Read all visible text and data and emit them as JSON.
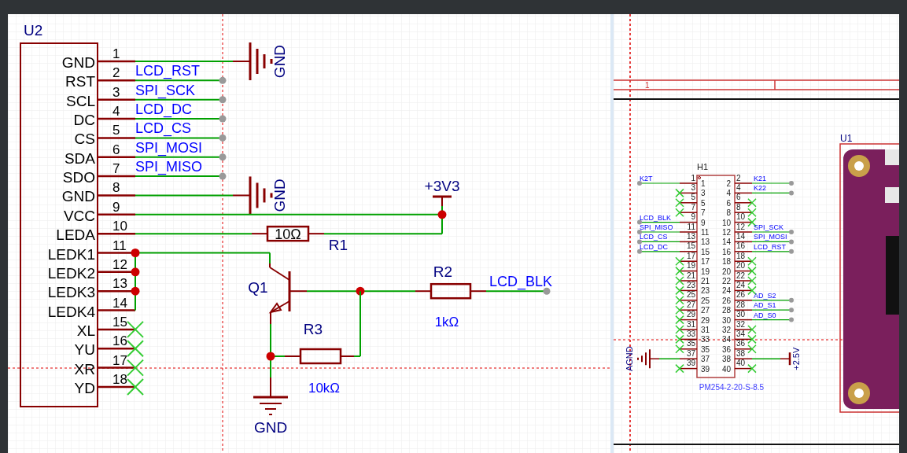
{
  "u2": {
    "designator": "U2",
    "pins": [
      {
        "number": "1",
        "name": "GND",
        "kind": "ground",
        "label": "GND"
      },
      {
        "number": "2",
        "name": "RST",
        "kind": "port",
        "net": "LCD_RST"
      },
      {
        "number": "3",
        "name": "SCL",
        "kind": "port",
        "net": "SPI_SCK"
      },
      {
        "number": "4",
        "name": "DC",
        "kind": "port",
        "net": "LCD_DC"
      },
      {
        "number": "5",
        "name": "CS",
        "kind": "port",
        "net": "LCD_CS"
      },
      {
        "number": "6",
        "name": "SDA",
        "kind": "port",
        "net": "SPI_MOSI"
      },
      {
        "number": "7",
        "name": "SDO",
        "kind": "port",
        "net": "SPI_MISO"
      },
      {
        "number": "8",
        "name": "GND",
        "kind": "ground",
        "label": "GND"
      },
      {
        "number": "9",
        "name": "VCC",
        "kind": "circuit"
      },
      {
        "number": "10",
        "name": "LEDA",
        "kind": "circuit"
      },
      {
        "number": "11",
        "name": "LEDK1",
        "kind": "circuit"
      },
      {
        "number": "12",
        "name": "LEDK2",
        "kind": "circuit"
      },
      {
        "number": "13",
        "name": "LEDK3",
        "kind": "circuit"
      },
      {
        "number": "14",
        "name": "LEDK4",
        "kind": "circuit"
      },
      {
        "number": "15",
        "name": "XL",
        "kind": "noconnect"
      },
      {
        "number": "16",
        "name": "YU",
        "kind": "noconnect"
      },
      {
        "number": "17",
        "name": "XR",
        "kind": "noconnect"
      },
      {
        "number": "18",
        "name": "YD",
        "kind": "noconnect"
      }
    ]
  },
  "circuit": {
    "power": "+3V3",
    "r1": {
      "designator": "R1",
      "value": "10Ω"
    },
    "q1": {
      "designator": "Q1"
    },
    "r2": {
      "designator": "R2",
      "value": "1kΩ"
    },
    "r3": {
      "designator": "R3",
      "value": "10kΩ"
    },
    "net": "LCD_BLK",
    "ground": "GND"
  },
  "h1": {
    "designator": "H1",
    "part": "PM254-2-20-S-8.5",
    "left_pins": [
      {
        "number": "1",
        "name": "1",
        "kind": "port",
        "net": "K2T"
      },
      {
        "number": "3",
        "name": "3",
        "kind": "noconnect"
      },
      {
        "number": "5",
        "name": "5",
        "kind": "noconnect"
      },
      {
        "number": "7",
        "name": "7",
        "kind": "noconnect"
      },
      {
        "number": "9",
        "name": "9",
        "kind": "port",
        "net": "LCD_BLK"
      },
      {
        "number": "11",
        "name": "11",
        "kind": "port",
        "net": "SPI_MISO"
      },
      {
        "number": "13",
        "name": "13",
        "kind": "port",
        "net": "LCD_CS"
      },
      {
        "number": "15",
        "name": "15",
        "kind": "port",
        "net": "LCD_DC"
      },
      {
        "number": "17",
        "name": "17",
        "kind": "noconnect"
      },
      {
        "number": "19",
        "name": "19",
        "kind": "noconnect"
      },
      {
        "number": "21",
        "name": "21",
        "kind": "noconnect"
      },
      {
        "number": "23",
        "name": "23",
        "kind": "noconnect"
      },
      {
        "number": "25",
        "name": "25",
        "kind": "noconnect"
      },
      {
        "number": "27",
        "name": "27",
        "kind": "noconnect"
      },
      {
        "number": "29",
        "name": "29",
        "kind": "noconnect"
      },
      {
        "number": "31",
        "name": "31",
        "kind": "noconnect"
      },
      {
        "number": "33",
        "name": "33",
        "kind": "noconnect"
      },
      {
        "number": "35",
        "name": "35",
        "kind": "noconnect"
      },
      {
        "number": "37",
        "name": "37",
        "kind": "ground",
        "label": "AGND"
      },
      {
        "number": "39",
        "name": "39",
        "kind": "noconnect"
      }
    ],
    "right_pins": [
      {
        "number": "2",
        "name": "2",
        "kind": "port",
        "net": "K21"
      },
      {
        "number": "4",
        "name": "4",
        "kind": "port",
        "net": "K22"
      },
      {
        "number": "6",
        "name": "6",
        "kind": "noconnect"
      },
      {
        "number": "8",
        "name": "8",
        "kind": "noconnect"
      },
      {
        "number": "10",
        "name": "10",
        "kind": "noconnect"
      },
      {
        "number": "12",
        "name": "12",
        "kind": "port",
        "net": "SPI_SCK"
      },
      {
        "number": "14",
        "name": "14",
        "kind": "port",
        "net": "SPI_MOSI"
      },
      {
        "number": "16",
        "name": "16",
        "kind": "port",
        "net": "LCD_RST"
      },
      {
        "number": "18",
        "name": "18",
        "kind": "noconnect"
      },
      {
        "number": "20",
        "name": "20",
        "kind": "noconnect"
      },
      {
        "number": "22",
        "name": "22",
        "kind": "noconnect"
      },
      {
        "number": "24",
        "name": "24",
        "kind": "noconnect"
      },
      {
        "number": "26",
        "name": "26",
        "kind": "port",
        "net": "AD_S2"
      },
      {
        "number": "28",
        "name": "28",
        "kind": "port",
        "net": "AD_S1"
      },
      {
        "number": "30",
        "name": "30",
        "kind": "port",
        "net": "AD_S0"
      },
      {
        "number": "32",
        "name": "32",
        "kind": "noconnect"
      },
      {
        "number": "34",
        "name": "34",
        "kind": "noconnect"
      },
      {
        "number": "36",
        "name": "36",
        "kind": "noconnect"
      },
      {
        "number": "38",
        "name": "38",
        "kind": "power",
        "label": "+2.5V"
      },
      {
        "number": "40",
        "name": "40",
        "kind": "noconnect"
      }
    ]
  },
  "u1": {
    "designator": "U1"
  },
  "title_block": {
    "cell": "1"
  }
}
